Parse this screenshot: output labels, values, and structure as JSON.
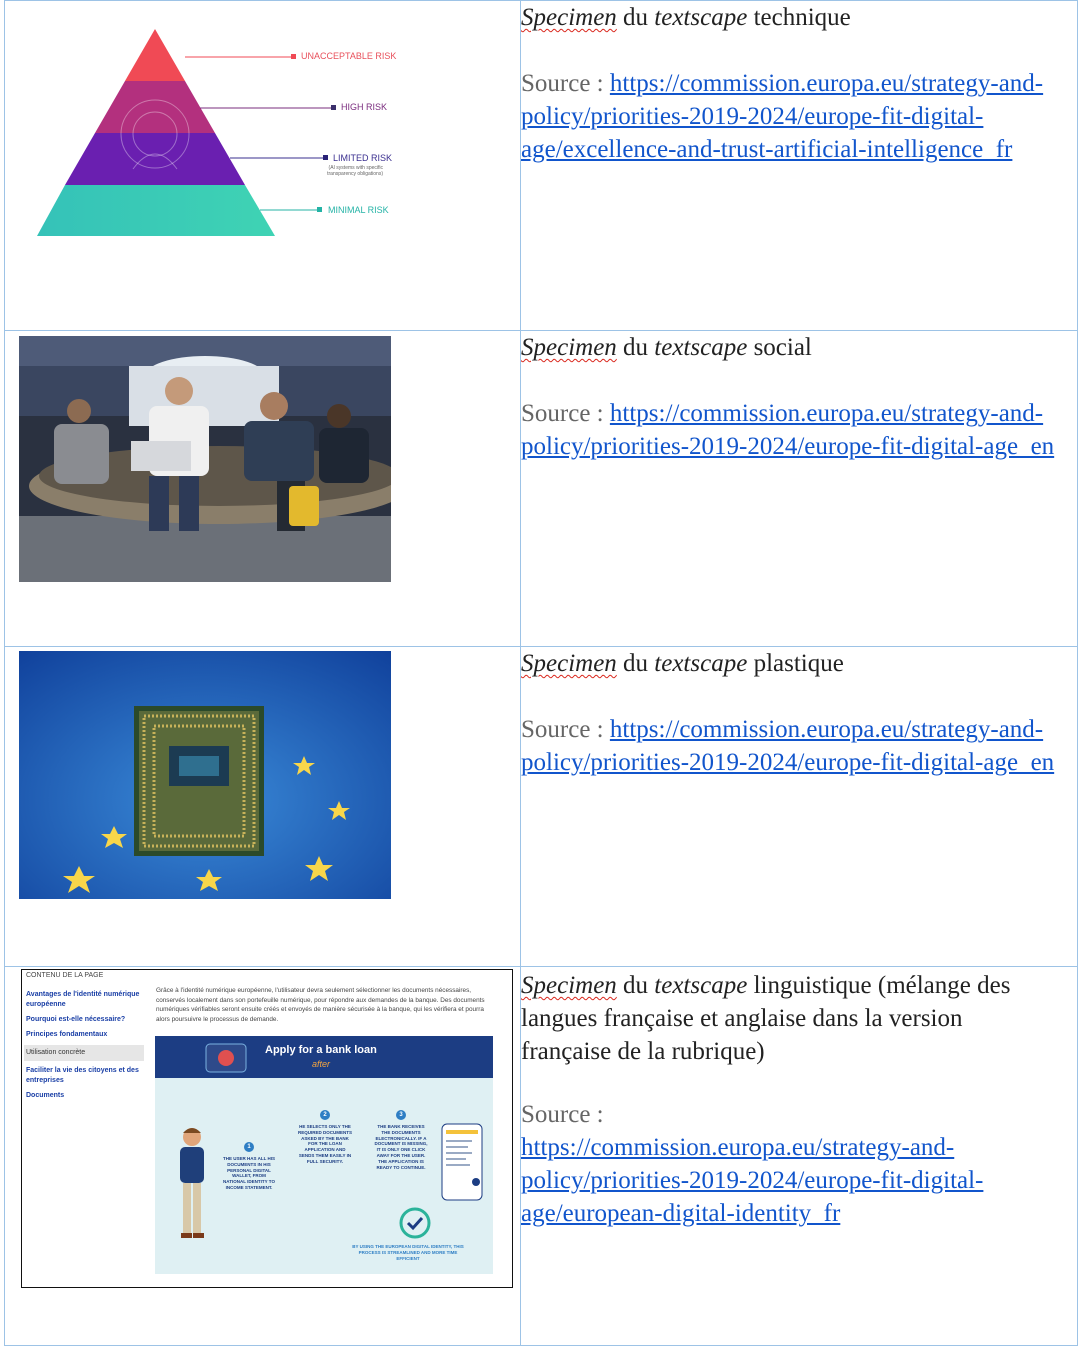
{
  "rows": [
    {
      "specimen_word": "Specimen",
      "du": "du",
      "textscape_word": "textscape",
      "kind": "technique",
      "source_label": "Source :",
      "link_text": "https://commission.europa.eu/strategy-and-policy/priorities-2019-2024/europe-fit-digital-age/excellence-and-trust-artificial-intelligence_fr",
      "image": "ai-risk-pyramid",
      "pyramid_labels": {
        "unacceptable": "UNACCEPTABLE RISK",
        "high": "HIGH RISK",
        "limited": "LIMITED RISK",
        "limited_note": "(AI systems with specific transparency obligations)",
        "minimal": "MINIMAL RISK"
      }
    },
    {
      "specimen_word": "Specimen",
      "du": "du",
      "textscape_word": "textscape",
      "kind": "social",
      "source_label": "Source :",
      "link_text": "https://commission.europa.eu/strategy-and-policy/priorities-2019-2024/europe-fit-digital-age_en",
      "image": "people-with-laptops-photo"
    },
    {
      "specimen_word": "Specimen",
      "du": "du",
      "textscape_word": "textscape",
      "kind": "plastique",
      "source_label": "Source :",
      "link_text": "https://commission.europa.eu/strategy-and-policy/priorities-2019-2024/europe-fit-digital-age_en",
      "image": "chip-on-eu-flag-photo"
    },
    {
      "specimen_word": "Specimen",
      "du": "du",
      "textscape_word": "textscape",
      "kind": "linguistique (mélange des langues française et anglaise dans la version française de la rubrique)",
      "source_label": "Source :",
      "link_text": "https://commission.europa.eu/strategy-and-policy/priorities-2019-2024/europe-fit-digital-age/european-digital-identity_fr",
      "image": "web-page-screenshot",
      "web": {
        "toc_title": "CONTENU DE LA PAGE",
        "toc": [
          "Avantages de l'identité numérique européenne",
          "Pourquoi est-elle nécessaire?",
          "Principes fondamentaux",
          "Utilisation concrète",
          "Faciliter la vie des citoyens et des entreprises",
          "Documents"
        ],
        "paragraph": "Grâce à l'identité numérique européenne, l'utilisateur devra seulement sélectionner les documents nécessaires, conservés localement dans son portefeuille numérique, pour répondre aux demandes de la banque. Des documents numériques vérifiables seront ensuite créés et envoyés de manière sécurisée à la banque, qui les vérifiera et pourra alors poursuivre le processus de demande.",
        "banner_title": "Apply for a bank loan",
        "banner_sub": "after",
        "steps": [
          {
            "n": "1",
            "text": "THE USER HAS ALL HIS DOCUMENTS IN HIS PERSONAL DIGITAL WALLET, FROM NATIONAL IDENTITY TO INCOME STATEMENT."
          },
          {
            "n": "2",
            "text": "HE SELECTS ONLY THE REQUIRED DOCUMENTS ASKED BY THE BANK FOR THE LOAN APPLICATION AND SENDS THEM EASILY IN FULL SECURITY."
          },
          {
            "n": "3",
            "text": "THE BANK RECEIVES THE DOCUMENTS ELECTRONICALLY. IF A DOCUMENT IS MISSING, IT IS ONLY ONE CLICK AWAY FOR THE USER. THE APPLICATION IS READY TO CONTINUE."
          }
        ],
        "footer": "BY USING THE EUROPEAN DIGITAL IDENTITY, THIS PROCESS IS STREAMLINED AND MORE TIME EFFICIENT"
      }
    }
  ]
}
